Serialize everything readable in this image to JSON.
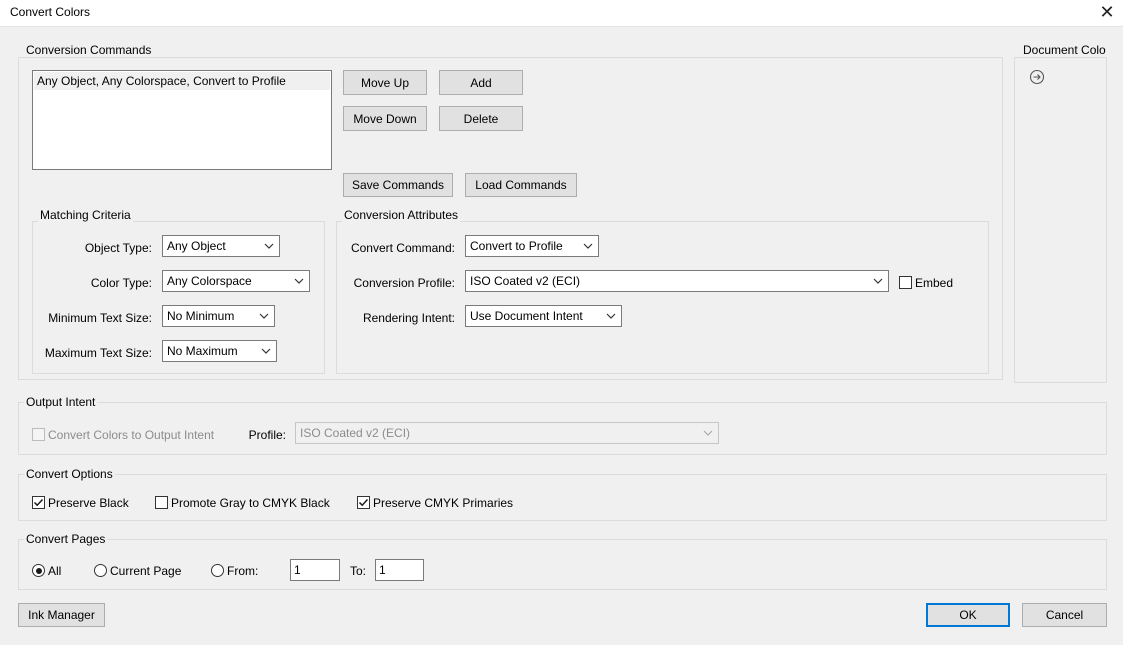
{
  "window": {
    "title": "Convert Colors",
    "close_glyph": "✕"
  },
  "conversion_commands": {
    "label": "Conversion Commands",
    "items": [
      "Any Object, Any Colorspace, Convert to Profile"
    ],
    "move_up": "Move Up",
    "add": "Add",
    "move_down": "Move Down",
    "delete": "Delete",
    "save_commands": "Save Commands",
    "load_commands": "Load Commands"
  },
  "document_colors": {
    "label": "Document Colo",
    "arrow_icon": "arrow-right-circle-icon"
  },
  "matching_criteria": {
    "label": "Matching Criteria",
    "object_type_label": "Object Type:",
    "object_type_value": "Any Object",
    "color_type_label": "Color Type:",
    "color_type_value": "Any Colorspace",
    "min_text_label": "Minimum Text Size:",
    "min_text_value": "No Minimum",
    "max_text_label": "Maximum Text Size:",
    "max_text_value": "No Maximum"
  },
  "conversion_attributes": {
    "label": "Conversion Attributes",
    "convert_command_label": "Convert Command:",
    "convert_command_value": "Convert to Profile",
    "profile_label": "Conversion Profile:",
    "profile_value": "ISO Coated v2 (ECI)",
    "embed_label": "Embed",
    "embed_checked": false,
    "intent_label": "Rendering Intent:",
    "intent_value": "Use Document Intent"
  },
  "output_intent": {
    "label": "Output Intent",
    "convert_label": "Convert Colors to Output Intent",
    "convert_checked": false,
    "profile_label": "Profile:",
    "profile_value": "ISO Coated v2 (ECI)"
  },
  "convert_options": {
    "label": "Convert Options",
    "preserve_black": "Preserve Black",
    "preserve_black_checked": true,
    "promote_gray": "Promote Gray to CMYK Black",
    "promote_gray_checked": false,
    "preserve_cmyk": "Preserve CMYK Primaries",
    "preserve_cmyk_checked": true
  },
  "convert_pages": {
    "label": "Convert Pages",
    "all": "All",
    "current": "Current Page",
    "from": "From:",
    "from_value": "1",
    "to": "To:",
    "to_value": "1",
    "selected": "All"
  },
  "footer": {
    "ink_manager": "Ink Manager",
    "ok": "OK",
    "cancel": "Cancel"
  },
  "colors": {
    "accent": "#0078d7",
    "dialog_bg": "#f0f0f0",
    "check_color": "#1a1a1a"
  }
}
